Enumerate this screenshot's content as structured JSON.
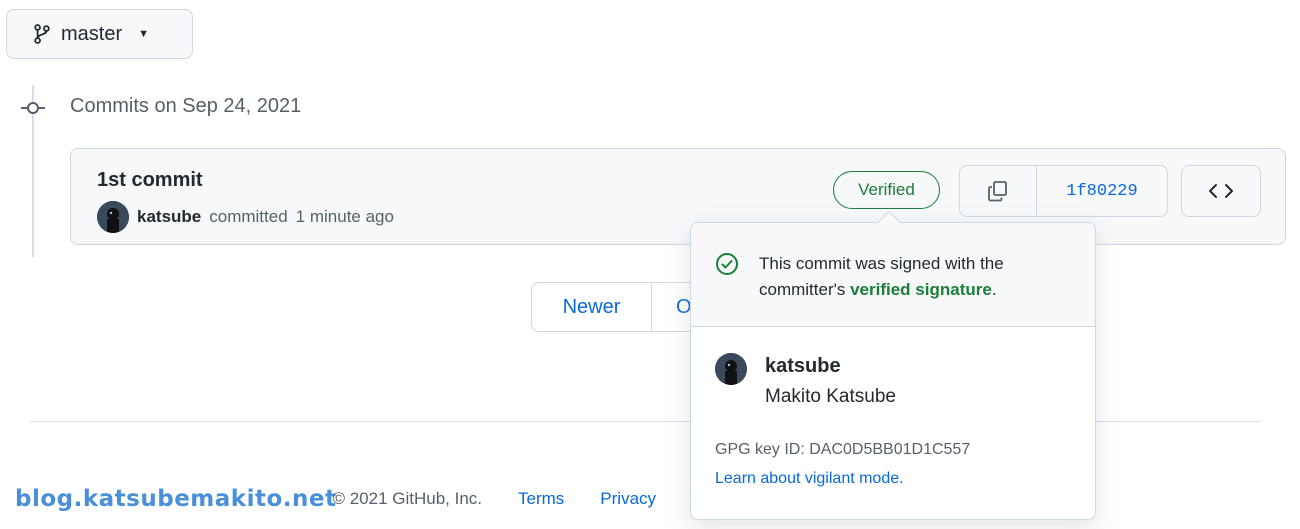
{
  "branch": {
    "name": "master"
  },
  "commits_heading": "Commits on Sep 24, 2021",
  "commit": {
    "title": "1st commit",
    "author": "katsube",
    "action": "committed",
    "time": "1 minute ago",
    "verified_label": "Verified",
    "sha": "1f80229"
  },
  "pager": {
    "newer": "Newer",
    "older": "O"
  },
  "popover": {
    "signed_prefix": "This commit was signed with the committer's ",
    "signed_link": "verified signature",
    "signed_suffix": ".",
    "login": "katsube",
    "full_name": "Makito Katsube",
    "gpg_label": "GPG key ID: ",
    "gpg_id": "DAC0D5BB01D1C557",
    "learn_link": "Learn about vigilant mode."
  },
  "footer": {
    "watermark": "blog.katsubemakito.net",
    "copyright": "© 2021 GitHub, Inc.",
    "links": [
      "Terms",
      "Privacy"
    ]
  },
  "colors": {
    "verified_green": "#1a7f37",
    "link_blue": "#0969da",
    "watermark_blue": "#4a90d9"
  },
  "icons": [
    "git-branch-icon",
    "caret-down-icon",
    "git-commit-icon",
    "copy-icon",
    "code-icon",
    "check-circle-icon"
  ]
}
